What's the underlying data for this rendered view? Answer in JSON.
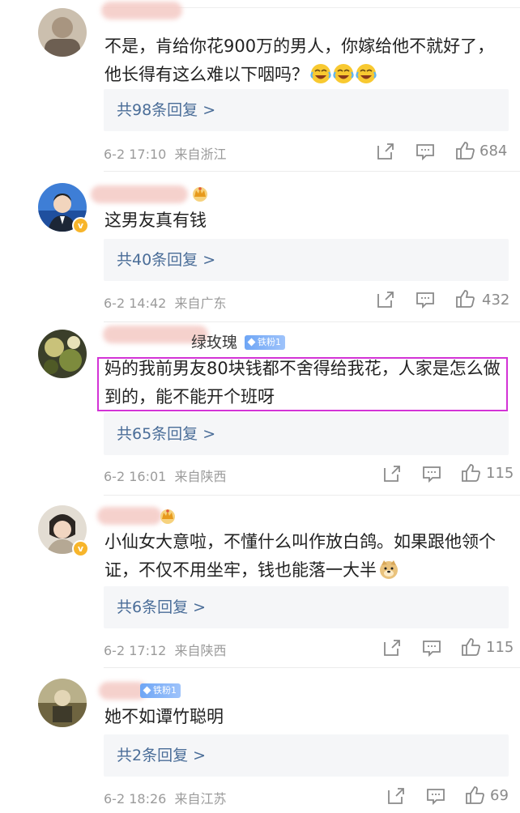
{
  "comments": [
    {
      "username": "",
      "badge": null,
      "has_crown": false,
      "verified": false,
      "text": "不是，肯给你花900万的男人，你嫁给他不就好了，他长得有这么难以下咽吗？",
      "emoji_count": 3,
      "emoji_icon": "laughing-crying-emoji",
      "replies_label": "共98条回复 >",
      "date": "6-2 17:10",
      "location": "来自浙江",
      "likes": "684"
    },
    {
      "username": "",
      "badge": null,
      "has_crown": true,
      "verified": true,
      "text": "这男友真有钱",
      "replies_label": "共40条回复 >",
      "date": "6-2 14:42",
      "location": "来自广东",
      "likes": "432"
    },
    {
      "username": "绿玫瑰",
      "badge": "铁粉1",
      "has_crown": false,
      "verified": false,
      "highlighted": true,
      "text": "妈的我前男友80块钱都不舍得给我花，人家是怎么做到的，能不能开个班呀",
      "replies_label": "共65条回复 >",
      "date": "6-2 16:01",
      "location": "来自陕西",
      "likes": "115"
    },
    {
      "username": "",
      "badge": null,
      "has_crown": true,
      "verified": true,
      "text": "小仙女大意啦，不懂什么叫作放白鸽。如果跟他领个证，不仅不用坐牢，钱也能落一大半",
      "emoji_count": 1,
      "emoji_icon": "doge-emoji",
      "replies_label": "共6条回复 >",
      "date": "6-2 17:12",
      "location": "来自陕西",
      "likes": "115"
    },
    {
      "username": "",
      "badge": "铁粉1",
      "has_crown": false,
      "verified": false,
      "text": "她不如谭竹聪明",
      "replies_label": "共2条回复 >",
      "date": "6-2 18:26",
      "location": "来自江苏",
      "likes": "69"
    }
  ],
  "icons": {
    "share": "share-icon",
    "comment": "comment-icon",
    "like": "thumbs-up-icon",
    "crown": "crown-icon",
    "verified": "verified-v-icon"
  },
  "colors": {
    "reply_link": "#4a6d98",
    "meta": "#9b9b9b",
    "highlight_border": "#d333d6",
    "fan_badge": "#7aaef7",
    "verify_badge": "#f7b52b"
  }
}
